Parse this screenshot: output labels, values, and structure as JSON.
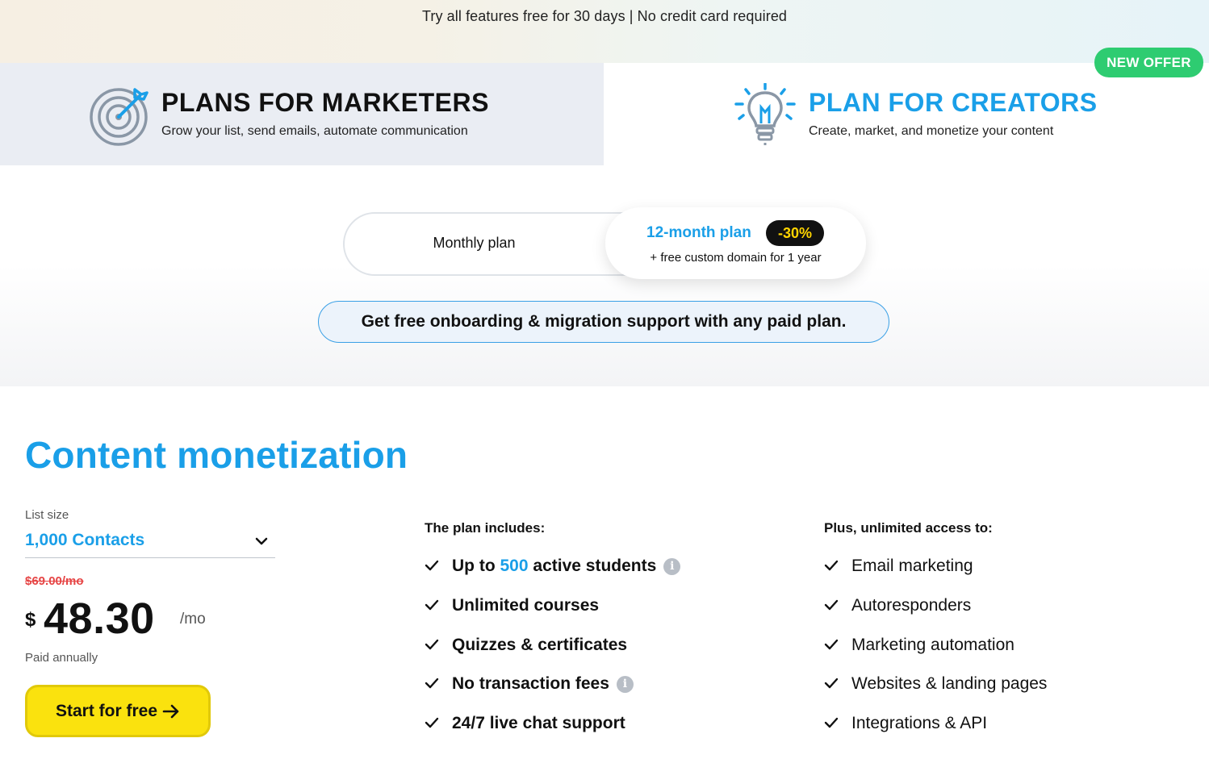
{
  "banner": {
    "text": "Try all features free for 30 days | No credit card required"
  },
  "tabs": {
    "marketers": {
      "title": "PLANS FOR MARKETERS",
      "subtitle": "Grow your list, send emails, automate communication",
      "icon": "target-icon"
    },
    "creators": {
      "title": "PLAN FOR CREATORS",
      "subtitle": "Create, market, and monetize your content",
      "icon": "lightbulb-icon",
      "badge": "NEW OFFER"
    }
  },
  "billing_toggle": {
    "monthly_label": "Monthly plan",
    "annual_label": "12-month plan",
    "annual_discount": "-30%",
    "annual_note": "+ free custom domain for 1 year",
    "selected": "12-month plan"
  },
  "support_banner": "Get free onboarding & migration support with any paid plan.",
  "plan": {
    "title": "Content monetization",
    "list_size_label": "List size",
    "list_size_value": "1,000 Contacts",
    "old_price": "$69.00/mo",
    "currency": "$",
    "price": "48.30",
    "period": "/mo",
    "billing_note": "Paid annually",
    "cta_label": "Start for free"
  },
  "includes": {
    "heading": "The plan includes:",
    "items": [
      {
        "pre": "Up to ",
        "highlight": "500",
        "post": " active students",
        "info": true
      },
      {
        "text": "Unlimited courses"
      },
      {
        "text": "Quizzes & certificates"
      },
      {
        "text": "No transaction fees",
        "info": true
      },
      {
        "text": "24/7 live chat support"
      }
    ]
  },
  "unlimited": {
    "heading": "Plus, unlimited access to:",
    "items": [
      "Email marketing",
      "Autoresponders",
      "Marketing automation",
      "Websites & landing pages",
      "Integrations & API"
    ]
  },
  "colors": {
    "accent_blue": "#1a9fe8",
    "cta_yellow": "#fae20e",
    "offer_green": "#2ecc71",
    "old_price_red": "#e64545"
  }
}
